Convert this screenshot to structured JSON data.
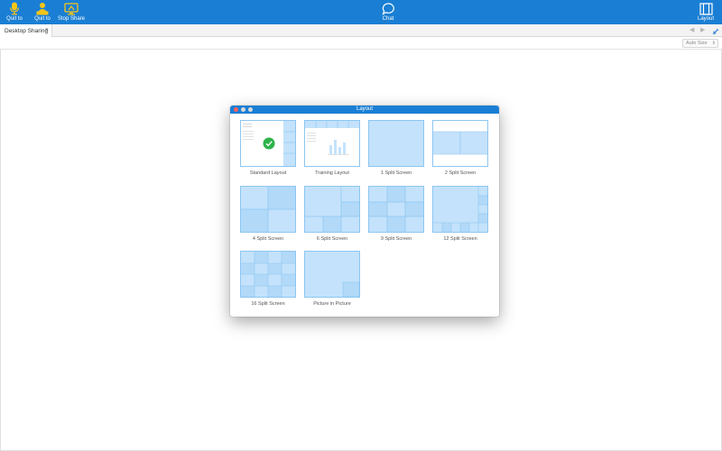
{
  "toolbar": {
    "quit_audio_label": "Quit to",
    "quit_video_label": "Quit to",
    "stop_share_label": "Stop Share",
    "chat_label": "Chat",
    "layout_label": "Layout"
  },
  "tabs": {
    "active_tab_label": "Desktop Sharing",
    "close_glyph": "×"
  },
  "view": {
    "zoom_select_value": "Auto Size"
  },
  "dialog": {
    "title": "Layout",
    "options": [
      {
        "label": "Standard Layout",
        "selected": true
      },
      {
        "label": "Training Layout",
        "selected": false
      },
      {
        "label": "1 Split Screen",
        "selected": false
      },
      {
        "label": "2 Split Screen",
        "selected": false
      },
      {
        "label": "4 Split Screen",
        "selected": false
      },
      {
        "label": "6 Split Screen",
        "selected": false
      },
      {
        "label": "9 Split Screen",
        "selected": false
      },
      {
        "label": "12 Split Screen",
        "selected": false
      },
      {
        "label": "16 Split Screen",
        "selected": false
      },
      {
        "label": "Picture in Picture",
        "selected": false
      }
    ]
  },
  "colors": {
    "toolbar_bg": "#1a7fd4",
    "accent_yellow": "#f5c518",
    "thumb_fill": "#c4e2fb",
    "thumb_border": "#8cc6f2",
    "check_green": "#2db34a"
  }
}
